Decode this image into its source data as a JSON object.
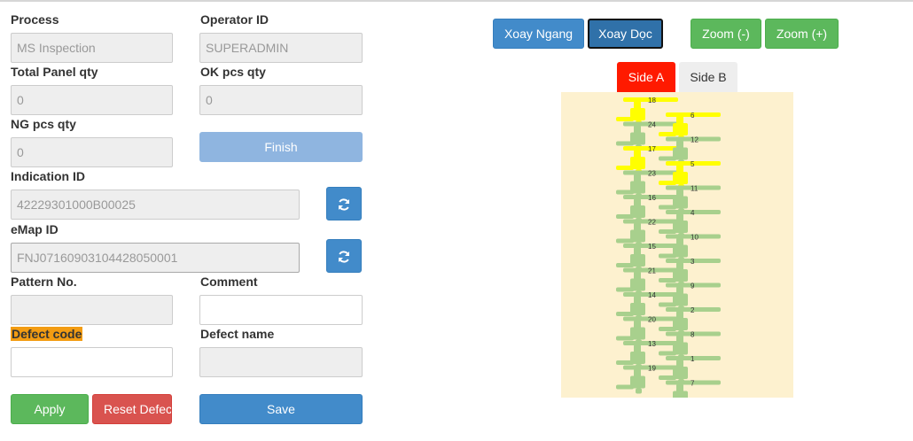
{
  "form": {
    "process": {
      "label": "Process",
      "value": "MS Inspection"
    },
    "operator_id": {
      "label": "Operator ID",
      "value": "SUPERADMIN"
    },
    "total_panel_qty": {
      "label": "Total Panel qty",
      "value": "0"
    },
    "ok_pcs_qty": {
      "label": "OK pcs qty",
      "value": "0"
    },
    "ng_pcs_qty": {
      "label": "NG pcs qty",
      "value": "0"
    },
    "finish_label": "Finish",
    "indication_id": {
      "label": "Indication ID",
      "value": "42229301000B00025"
    },
    "emap_id": {
      "label": "eMap ID",
      "value": "FNJ07160903104428050001"
    },
    "pattern_no": {
      "label": "Pattern No.",
      "value": ""
    },
    "comment": {
      "label": "Comment",
      "value": ""
    },
    "defect_code": {
      "label": "Defect code",
      "value": ""
    },
    "defect_name": {
      "label": "Defect name",
      "value": ""
    },
    "apply_label": "Apply",
    "reset_label": "Reset Defect",
    "save_label": "Save"
  },
  "toolbar": {
    "rotate_horizontal": "Xoay Ngang",
    "rotate_vertical": "Xoay Dọc",
    "zoom_out": "Zoom (-)",
    "zoom_in": "Zoom (+)"
  },
  "tabs": {
    "side_a": "Side A",
    "side_b": "Side B"
  },
  "colors": {
    "piece_normal": "#a8d08d",
    "piece_defect": "#ffff00",
    "map_background": "#fdf1cf",
    "side_a_active": "#ff1a00"
  },
  "map": {
    "pieces": [
      {
        "id": "18",
        "col": 0,
        "row": 0,
        "status": "defect"
      },
      {
        "id": "24",
        "col": 0,
        "row": 1,
        "status": "ok"
      },
      {
        "id": "17",
        "col": 0,
        "row": 2,
        "status": "defect"
      },
      {
        "id": "23",
        "col": 0,
        "row": 3,
        "status": "ok"
      },
      {
        "id": "16",
        "col": 0,
        "row": 4,
        "status": "ok"
      },
      {
        "id": "22",
        "col": 0,
        "row": 5,
        "status": "ok"
      },
      {
        "id": "15",
        "col": 0,
        "row": 6,
        "status": "ok"
      },
      {
        "id": "21",
        "col": 0,
        "row": 7,
        "status": "ok"
      },
      {
        "id": "14",
        "col": 0,
        "row": 8,
        "status": "ok"
      },
      {
        "id": "20",
        "col": 0,
        "row": 9,
        "status": "ok"
      },
      {
        "id": "13",
        "col": 0,
        "row": 10,
        "status": "ok"
      },
      {
        "id": "19",
        "col": 0,
        "row": 11,
        "status": "ok"
      },
      {
        "id": "6",
        "col": 1,
        "row": 0,
        "status": "defect"
      },
      {
        "id": "12",
        "col": 1,
        "row": 1,
        "status": "ok"
      },
      {
        "id": "5",
        "col": 1,
        "row": 2,
        "status": "defect"
      },
      {
        "id": "11",
        "col": 1,
        "row": 3,
        "status": "ok"
      },
      {
        "id": "4",
        "col": 1,
        "row": 4,
        "status": "ok"
      },
      {
        "id": "10",
        "col": 1,
        "row": 5,
        "status": "ok"
      },
      {
        "id": "3",
        "col": 1,
        "row": 6,
        "status": "ok"
      },
      {
        "id": "9",
        "col": 1,
        "row": 7,
        "status": "ok"
      },
      {
        "id": "2",
        "col": 1,
        "row": 8,
        "status": "ok"
      },
      {
        "id": "8",
        "col": 1,
        "row": 9,
        "status": "ok"
      },
      {
        "id": "1",
        "col": 1,
        "row": 10,
        "status": "ok"
      },
      {
        "id": "7",
        "col": 1,
        "row": 11,
        "status": "ok"
      }
    ]
  }
}
